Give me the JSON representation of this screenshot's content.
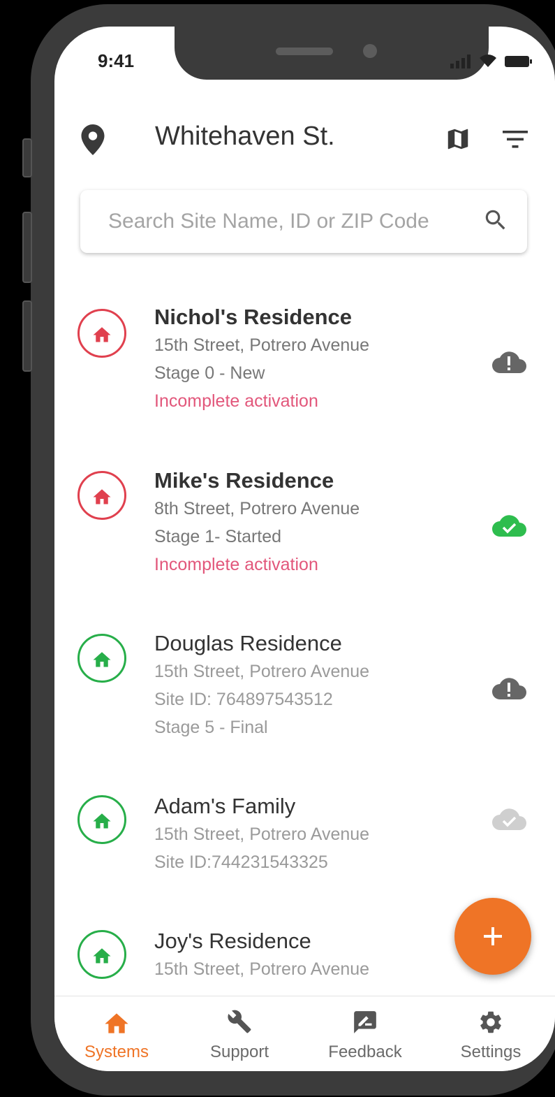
{
  "status_bar": {
    "time": "9:41"
  },
  "header": {
    "title": "Whitehaven St."
  },
  "search": {
    "placeholder": "Search Site Name, ID or ZIP Code"
  },
  "colors": {
    "accent": "#ef7426",
    "incomplete": "#e2577b",
    "red_home": "#e0404e",
    "green_home": "#27ae49",
    "cloud_ok": "#2ebd4e",
    "cloud_warn": "#666666"
  },
  "sites": [
    {
      "name": "Nichol's Residence",
      "lines": [
        "15th Street, Potrero Avenue",
        "Stage 0 - New"
      ],
      "warning": "Incomplete activation",
      "status": "red",
      "cloud": "cloud-alert-icon"
    },
    {
      "name": "Mike's Residence",
      "lines": [
        "8th Street, Potrero Avenue",
        "Stage 1- Started"
      ],
      "warning": "Incomplete activation",
      "status": "red",
      "cloud": "cloud-check-icon"
    },
    {
      "name": "Douglas Residence",
      "lines": [
        "15th Street, Potrero Avenue",
        "Site ID: 764897543512",
        "Stage 5 - Final"
      ],
      "status": "green",
      "cloud": "cloud-alert-icon"
    },
    {
      "name": "Adam's Family",
      "lines": [
        "15th Street, Potrero Avenue",
        "Site ID:744231543325"
      ],
      "status": "green",
      "cloud": "cloud-check-faded-icon"
    },
    {
      "name": "Joy's Residence",
      "lines": [
        "15th Street, Potrero Avenue"
      ],
      "status": "green"
    }
  ],
  "tabs": [
    {
      "label": "Systems",
      "icon": "home-icon",
      "active": true
    },
    {
      "label": "Support",
      "icon": "wrench-icon"
    },
    {
      "label": "Feedback",
      "icon": "feedback-icon"
    },
    {
      "label": "Settings",
      "icon": "gear-icon"
    }
  ]
}
